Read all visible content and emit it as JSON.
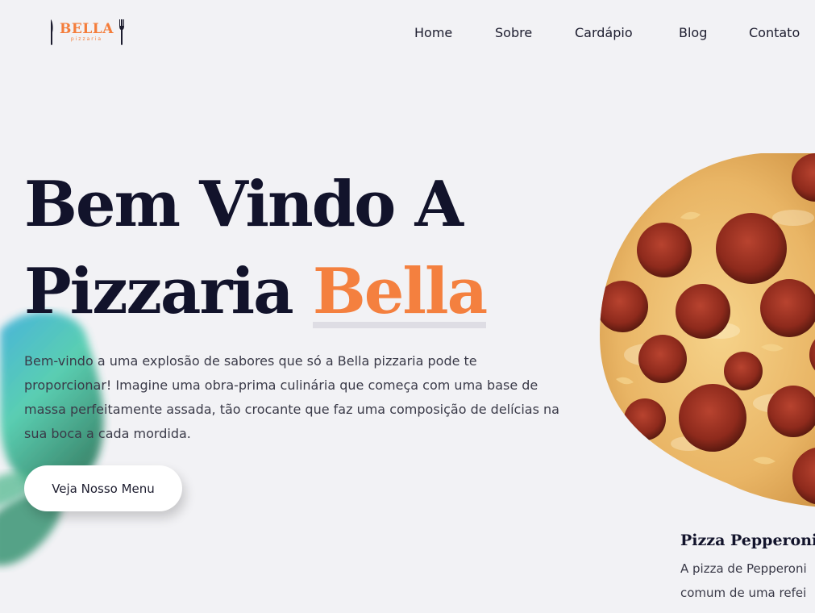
{
  "brand": {
    "name": "BELLA",
    "tagline": "pizzaria"
  },
  "nav": {
    "items": [
      "Home",
      "Sobre",
      "Cardápio",
      "Blog",
      "Contato"
    ]
  },
  "hero": {
    "title_line1": "Bem Vindo A",
    "title_line2_plain": "Pizzaria ",
    "title_line2_accent": "Bella",
    "description": "Bem-vindo a uma explosão de sabores que só a Bella pizzaria pode te proporcionar! Imagine uma obra-prima culinária que começa com uma base de massa perfeitamente assada, tão crocante que faz uma composição de delícias na sua boca a cada mordida.",
    "cta_label": "Veja Nosso Menu"
  },
  "featured": {
    "title": "Pizza Pepperoni",
    "desc_line1": "A pizza de Pepperoni",
    "desc_line2": "comum de uma refei"
  },
  "colors": {
    "accent": "#f4803f",
    "text_dark": "#12132b",
    "background": "#f2f2f5"
  }
}
